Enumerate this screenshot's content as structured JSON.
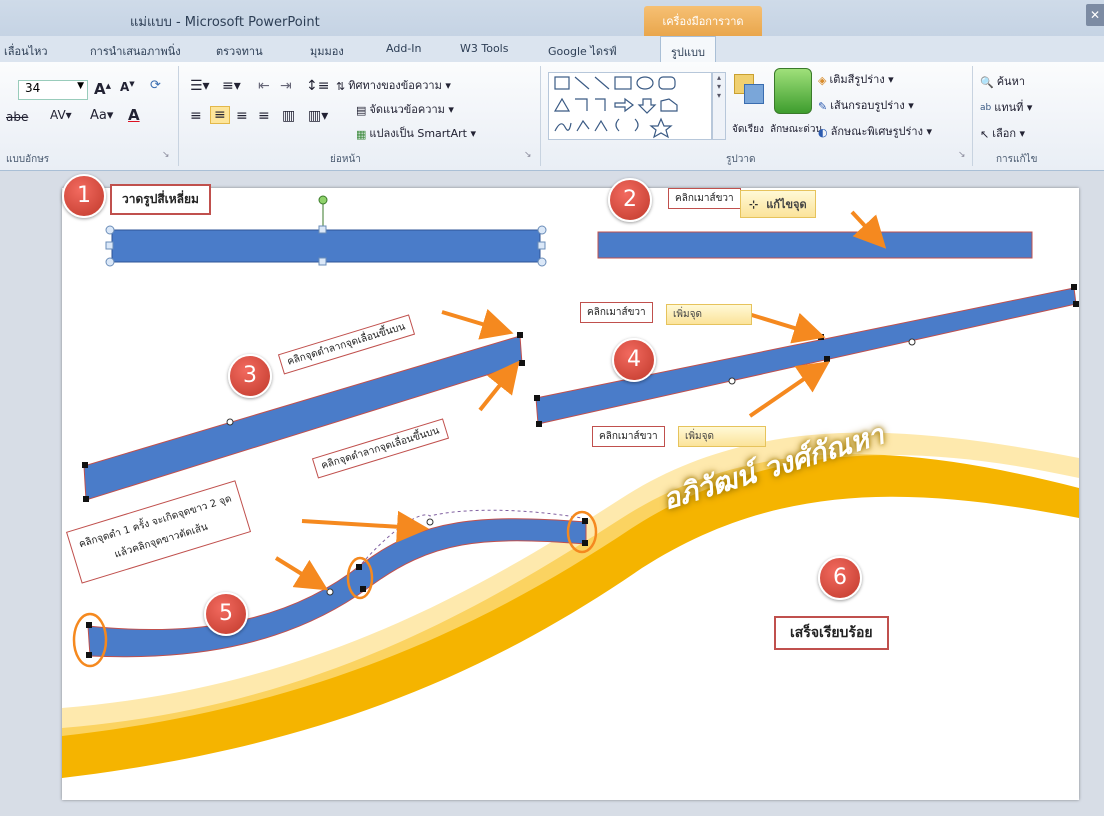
{
  "window": {
    "title": "แม่แบบ - Microsoft PowerPoint",
    "context_tab_title": "เครื่องมือการวาด"
  },
  "tabs": [
    "เลื่อนไหว",
    "การนำเสนอภาพนิ่ง",
    "ตรวจทาน",
    "มุมมอง",
    "Add-In",
    "W3 Tools",
    "Google ไดรฟ์",
    "รูปแบบ"
  ],
  "ribbon": {
    "font_size": "34",
    "groups": {
      "font": "แบบอักษร",
      "paragraph": "ย่อหน้า",
      "drawing": "รูปวาด",
      "editing": "การแก้ไข"
    },
    "buttons": {
      "text_direction": "ทิศทางของข้อความ",
      "align_text": "จัดแนวข้อความ",
      "convert_smartart": "แปลงเป็น SmartArt",
      "arrange": "จัดเรียง",
      "quick_styles": "ลักษณะด่วน",
      "shape_fill": "เติมสีรูปร่าง",
      "shape_outline": "เส้นกรอบรูปร่าง",
      "shape_effects": "ลักษณะพิเศษรูปร่าง",
      "find": "ค้นหา",
      "replace": "แทนที่",
      "select": "เลือก"
    }
  },
  "slide": {
    "steps": [
      "1",
      "2",
      "3",
      "4",
      "5",
      "6"
    ],
    "labels": {
      "step1": "วาดรูปสี่เหลี่ยม",
      "right_click": "คลิกเมาส์ขวา",
      "edit_points": "แก้ไขจุด",
      "add_point": "เพิ่มจุด",
      "drag_up": "คลิกจุดดำลากจุดเลื่อนขึ้นบน",
      "step5_line1": "คลิกจุดดำ 1 ครั้ง จะเกิดจุดขาว 2 จุด",
      "step5_line2": "แล้วคลิกจุดขาวดัดเส้น",
      "done": "เสร็จเรียบร้อย",
      "author": "อภิวัฒน์ วงศ์กัณหา"
    },
    "colors": {
      "shape_blue": "#4a7cc9",
      "arrow_orange": "#f5891f",
      "badge_red": "#d9453a",
      "swoosh_yellow": "#f5b400"
    }
  }
}
